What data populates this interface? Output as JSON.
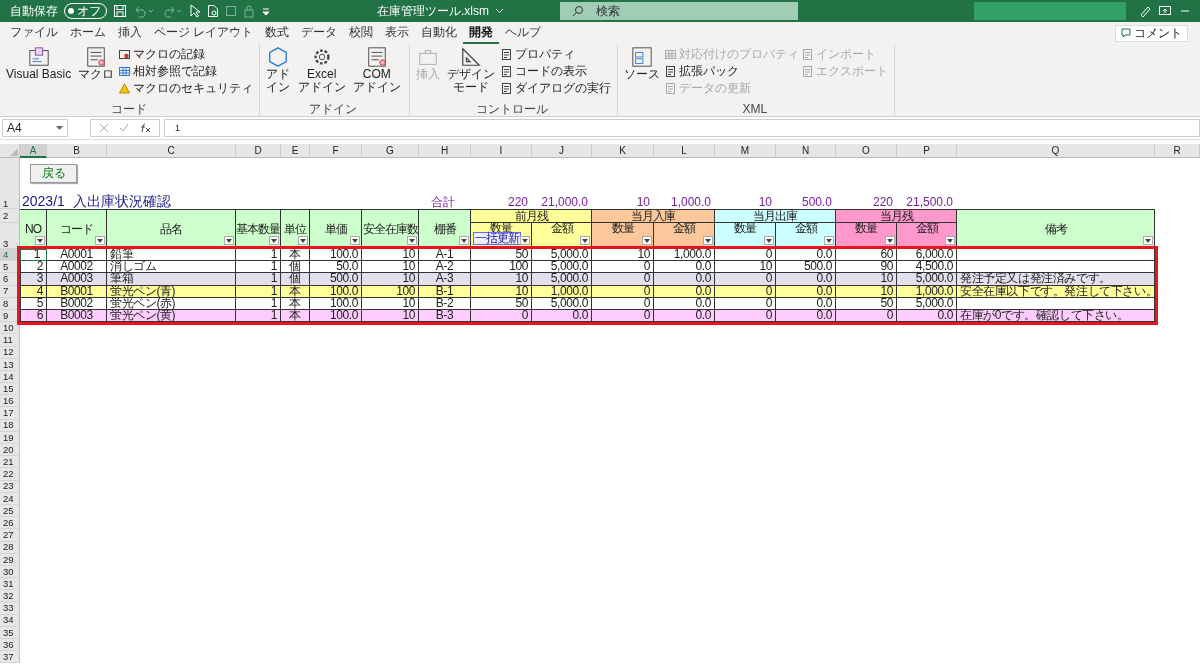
{
  "title_bar": {
    "autosave_label": "自動保存",
    "autosave_toggle": {
      "label": "オフ",
      "on": false
    },
    "filename": "在庫管理ツール.xlsm",
    "search": {
      "placeholder": "検索"
    }
  },
  "menu_tabs": [
    {
      "label": "ファイル",
      "selected": false
    },
    {
      "label": "ホーム",
      "selected": false
    },
    {
      "label": "挿入",
      "selected": false
    },
    {
      "label": "ページ レイアウト",
      "selected": false
    },
    {
      "label": "数式",
      "selected": false
    },
    {
      "label": "データ",
      "selected": false
    },
    {
      "label": "校閲",
      "selected": false
    },
    {
      "label": "表示",
      "selected": false
    },
    {
      "label": "自動化",
      "selected": false
    },
    {
      "label": "開発",
      "selected": true
    },
    {
      "label": "ヘルプ",
      "selected": false
    }
  ],
  "comment_button": "コメント",
  "ribbon_groups": [
    {
      "label": "コード",
      "large": [
        {
          "label": "Visual Basic",
          "disabled": false
        },
        {
          "label": "マクロ",
          "disabled": false
        }
      ],
      "small_columns": [
        [
          {
            "label": "マクロの記録",
            "disabled": false
          },
          {
            "label": "相対参照で記録",
            "disabled": false
          },
          {
            "label": "マクロのセキュリティ",
            "disabled": false
          }
        ]
      ]
    },
    {
      "label": "アドイン",
      "large": [
        {
          "label": "アドイン",
          "disabled": false
        },
        {
          "label": "Excel\nアドイン",
          "disabled": false
        },
        {
          "label": "COM\nアドイン",
          "disabled": false
        }
      ]
    },
    {
      "label": "コントロール",
      "large": [
        {
          "label": "挿入",
          "disabled": true
        },
        {
          "label": "デザインモード",
          "disabled": false
        }
      ],
      "small_columns": [
        [
          {
            "label": "プロパティ",
            "disabled": false
          },
          {
            "label": "コードの表示",
            "disabled": false
          },
          {
            "label": "ダイアログの実行",
            "disabled": false
          }
        ]
      ]
    },
    {
      "label": "XML",
      "large": [
        {
          "label": "ソース",
          "disabled": false
        }
      ],
      "small_columns": [
        [
          {
            "label": "対応付けのプロパティ",
            "disabled": true
          },
          {
            "label": "拡張パック",
            "disabled": false
          },
          {
            "label": "データの更新",
            "disabled": true
          }
        ],
        [
          {
            "label": "インポート",
            "disabled": true
          },
          {
            "label": "エクスポート",
            "disabled": true
          }
        ]
      ]
    }
  ],
  "formula_bar": {
    "name_box": "A4",
    "value": "1"
  },
  "sheet": {
    "column_headers": [
      {
        "label": "A",
        "selected": true
      },
      {
        "label": "B",
        "selected": false
      },
      {
        "label": "C",
        "selected": false
      },
      {
        "label": "D",
        "selected": false
      },
      {
        "label": "E",
        "selected": false
      },
      {
        "label": "F",
        "selected": false
      },
      {
        "label": "G",
        "selected": false
      },
      {
        "label": "H",
        "selected": false
      },
      {
        "label": "I",
        "selected": false
      },
      {
        "label": "J",
        "selected": false
      },
      {
        "label": "K",
        "selected": false
      },
      {
        "label": "L",
        "selected": false
      },
      {
        "label": "M",
        "selected": false
      },
      {
        "label": "N",
        "selected": false
      },
      {
        "label": "O",
        "selected": false
      },
      {
        "label": "P",
        "selected": false
      },
      {
        "label": "Q",
        "selected": false
      },
      {
        "label": "R",
        "selected": false
      }
    ],
    "row_headers": [
      {
        "label": "1",
        "selected": false
      },
      {
        "label": "2",
        "selected": false
      },
      {
        "label": "3",
        "selected": false
      },
      {
        "label": "4",
        "selected": true
      },
      {
        "label": "5",
        "selected": false
      },
      {
        "label": "6",
        "selected": false
      },
      {
        "label": "7",
        "selected": false
      },
      {
        "label": "8",
        "selected": false
      },
      {
        "label": "9",
        "selected": false
      },
      {
        "label": "10",
        "selected": false
      },
      {
        "label": "11",
        "selected": false
      },
      {
        "label": "12",
        "selected": false
      },
      {
        "label": "13",
        "selected": false
      },
      {
        "label": "14",
        "selected": false
      },
      {
        "label": "15",
        "selected": false
      },
      {
        "label": "16",
        "selected": false
      },
      {
        "label": "17",
        "selected": false
      },
      {
        "label": "18",
        "selected": false
      },
      {
        "label": "19",
        "selected": false
      },
      {
        "label": "20",
        "selected": false
      },
      {
        "label": "21",
        "selected": false
      },
      {
        "label": "22",
        "selected": false
      },
      {
        "label": "23",
        "selected": false
      },
      {
        "label": "24",
        "selected": false
      },
      {
        "label": "25",
        "selected": false
      },
      {
        "label": "26",
        "selected": false
      },
      {
        "label": "27",
        "selected": false
      },
      {
        "label": "28",
        "selected": false
      },
      {
        "label": "29",
        "selected": false
      },
      {
        "label": "30",
        "selected": false
      },
      {
        "label": "31",
        "selected": false
      },
      {
        "label": "32",
        "selected": false
      },
      {
        "label": "33",
        "selected": false
      },
      {
        "label": "34",
        "selected": false
      },
      {
        "label": "35",
        "selected": false
      },
      {
        "label": "36",
        "selected": false
      },
      {
        "label": "37",
        "selected": false
      }
    ],
    "back_button": "戻る",
    "title": "2023/1  入出庫状況確認",
    "totals_label": "合計",
    "totals": [
      "220",
      "21,000.0",
      "10",
      "1,000.0",
      "10",
      "500.0",
      "220",
      "21,500.0"
    ],
    "fixed_headers": [
      {
        "label": "NO",
        "color": "#ccffcc"
      },
      {
        "label": "コード",
        "color": "#ccffcc"
      },
      {
        "label": "品名",
        "color": "#ccffcc"
      },
      {
        "label": "基本数量",
        "color": "#ccffcc"
      },
      {
        "label": "単位",
        "color": "#ccffcc"
      },
      {
        "label": "単価",
        "color": "#ccffcc"
      },
      {
        "label": "安全在庫数",
        "color": "#ccffcc"
      },
      {
        "label": "棚番",
        "color": "#ccffcc"
      }
    ],
    "groups": [
      {
        "label": "前月残",
        "color": "#ffff99",
        "subcolumns": [
          "数量",
          "金額"
        ]
      },
      {
        "label": "当月入庫",
        "color": "#fcc89b",
        "subcolumns": [
          "数量",
          "金額"
        ]
      },
      {
        "label": "当月出庫",
        "color": "#ccffff",
        "subcolumns": [
          "数量",
          "金額"
        ]
      },
      {
        "label": "当月残",
        "color": "#ff99cc",
        "subcolumns": [
          "数量",
          "金額"
        ]
      }
    ],
    "bulk_update_button": "一括更新",
    "notes_header": {
      "label": "備考",
      "color": "#ccffcc"
    },
    "rows": [
      {
        "color": "#ffffff",
        "cells": [
          "1",
          "A0001",
          "鉛筆",
          "1",
          "本",
          "100.0",
          "10",
          "A-1",
          "50",
          "5,000.0",
          "10",
          "1,000.0",
          "0",
          "0.0",
          "60",
          "6,000.0",
          ""
        ]
      },
      {
        "color": "#ffffff",
        "cells": [
          "2",
          "A0002",
          "消しゴム",
          "1",
          "個",
          "50.0",
          "10",
          "A-2",
          "100",
          "5,000.0",
          "0",
          "0.0",
          "10",
          "500.0",
          "90",
          "4,500.0",
          ""
        ]
      },
      {
        "color": "#e4dfec",
        "cells": [
          "3",
          "A0003",
          "筆箱",
          "1",
          "個",
          "500.0",
          "10",
          "A-3",
          "10",
          "5,000.0",
          "0",
          "0.0",
          "0",
          "0.0",
          "10",
          "5,000.0",
          "発注予定又は発注済みです。"
        ]
      },
      {
        "color": "#ffff99",
        "cells": [
          "4",
          "B0001",
          "蛍光ペン(青)",
          "1",
          "本",
          "100.0",
          "100",
          "B-1",
          "10",
          "1,000.0",
          "0",
          "0.0",
          "0",
          "0.0",
          "10",
          "1,000.0",
          "安全在庫以下です。発注して下さい。"
        ]
      },
      {
        "color": "#ffffff",
        "cells": [
          "5",
          "B0002",
          "蛍光ペン(赤)",
          "1",
          "本",
          "100.0",
          "10",
          "B-2",
          "50",
          "5,000.0",
          "0",
          "0.0",
          "0",
          "0.0",
          "50",
          "5,000.0",
          ""
        ]
      },
      {
        "color": "#ffccff",
        "cells": [
          "6",
          "B0003",
          "蛍光ペン(黄)",
          "1",
          "本",
          "100.0",
          "10",
          "B-3",
          "0",
          "0.0",
          "0",
          "0.0",
          "0",
          "0.0",
          "0",
          "0.0",
          "在庫が0です。確認して下さい。"
        ]
      }
    ],
    "highlight_frame": true
  }
}
